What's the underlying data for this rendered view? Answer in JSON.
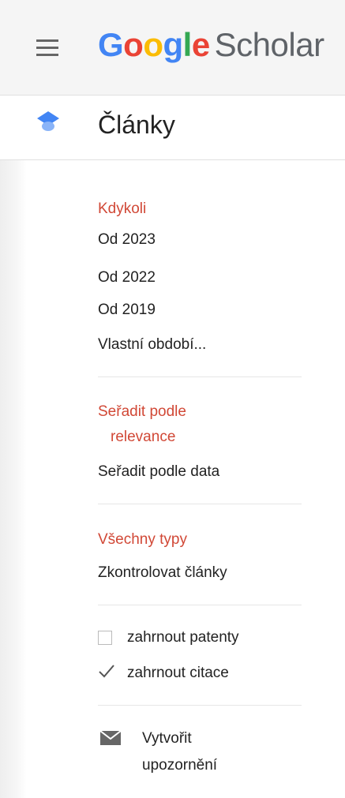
{
  "header": {
    "logo_letters": [
      "G",
      "o",
      "o",
      "g",
      "l",
      "e"
    ],
    "logo_suffix": "Scholar",
    "menu_icon": "hamburger-menu-icon"
  },
  "section": {
    "icon": "graduation-cap-icon",
    "title": "Články"
  },
  "time_filter": {
    "items": [
      {
        "label": "Kdykoli",
        "active": true
      },
      {
        "label": "Od 2023",
        "active": false
      },
      {
        "label": "Od 2022",
        "active": false
      },
      {
        "label": "Od 2019",
        "active": false
      },
      {
        "label": "Vlastní období...",
        "active": false
      }
    ]
  },
  "sort": {
    "relevance_line1": "Seřadit podle",
    "relevance_line2": "relevance",
    "by_date": "Seřadit podle data"
  },
  "types": {
    "all_types": "Všechny typy",
    "review_articles": "Zkontrolovat články"
  },
  "options": {
    "patents_label": "zahrnout patenty",
    "patents_checked": false,
    "citations_label": "zahrnout citace",
    "citations_checked": true
  },
  "alert": {
    "icon": "envelope-icon",
    "label_line1": "Vytvořit",
    "label_line2": "upozornění"
  },
  "colors": {
    "active": "#d14836",
    "text": "#222222",
    "blue": "#4285f4"
  }
}
